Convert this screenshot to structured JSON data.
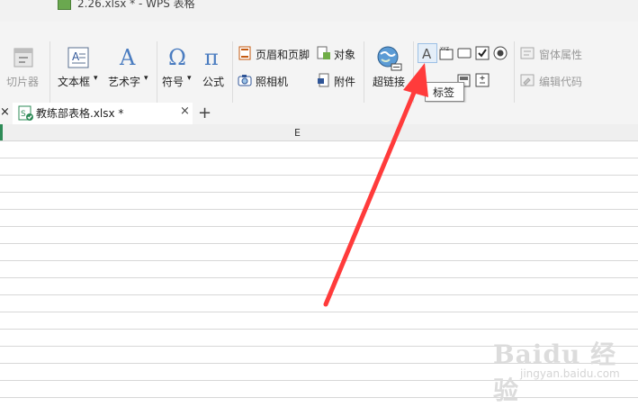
{
  "window": {
    "title": "2.26.xlsx * - WPS 表格"
  },
  "ribbon": {
    "slicer": "切片器",
    "textbox": "文本框",
    "wordart": "艺术字",
    "symbol": "符号",
    "formula": "公式",
    "header_footer": "页眉和页脚",
    "object": "对象",
    "camera": "照相机",
    "attachment": "附件",
    "hyperlink": "超链接",
    "control_props": "窗体属性",
    "edit_code": "编辑代码",
    "dropdown_arrow": "▾"
  },
  "tooltip": {
    "text": "标签"
  },
  "tabs": {
    "file_tab": "教练部表格.xlsx *",
    "close": "×",
    "add": "+"
  },
  "sheet": {
    "column_label": "E"
  },
  "watermark": {
    "main": "Baidu 经验",
    "sub": "jingyan.baidu.com"
  },
  "colors": {
    "arrow": "#ff3b3b",
    "accent_green": "#2e8b57"
  }
}
